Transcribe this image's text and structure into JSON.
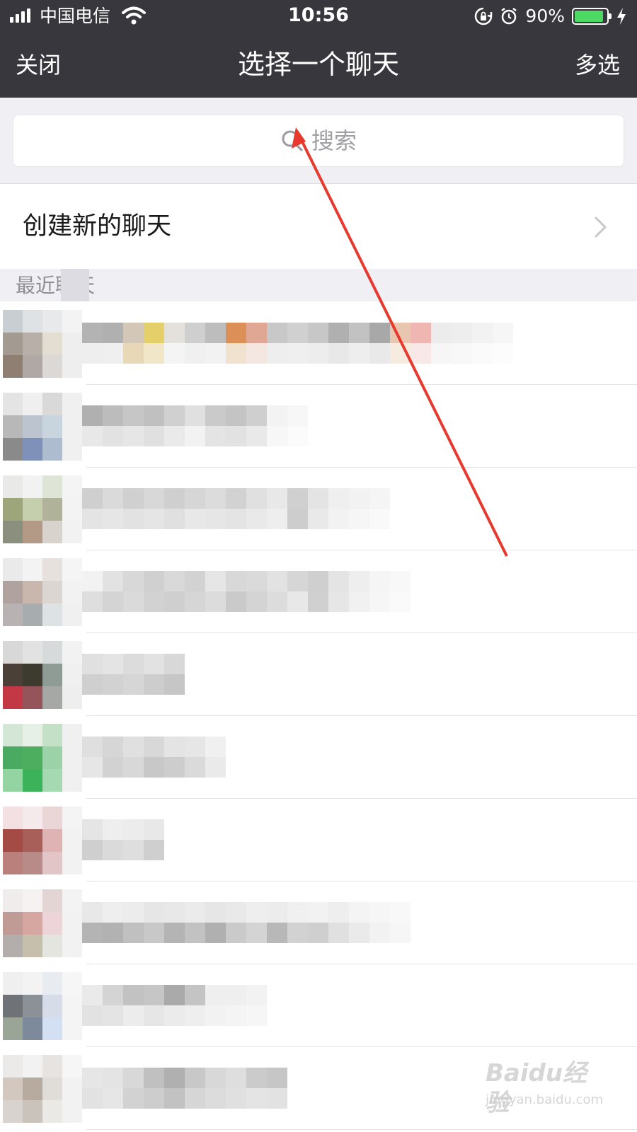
{
  "status_bar": {
    "carrier": "中国电信",
    "time": "10:56",
    "battery_percent": "90%",
    "battery_level": 0.9,
    "battery_color": "#4cd964",
    "icons": [
      "signal-icon",
      "wifi-icon",
      "rotation-lock-icon",
      "alarm-icon",
      "battery-icon",
      "charging-icon"
    ]
  },
  "navbar": {
    "left_label": "关闭",
    "title": "选择一个聊天",
    "right_label": "多选",
    "background": "#38373d"
  },
  "search": {
    "placeholder": "搜索",
    "icon": "search-icon"
  },
  "create_new": {
    "label": "创建新的聊天",
    "icon": "chevron-right-icon"
  },
  "section": {
    "label": "最近聊天"
  },
  "chats": [
    {
      "name": "(redacted)",
      "avatar_colors": [
        "#c9ced3",
        "#dfe2e5",
        "#e8e9ea",
        "#f3f3f3",
        "#a39a91",
        "#b8b0a8",
        "#e3ddd2",
        "#eeeeee",
        "#8f7f72",
        "#b0a8a5",
        "#dcd8d6",
        "#eeeeee"
      ],
      "name_colors": [
        "#b3b3b3",
        "#eeeeee",
        "#b0b0b0",
        "#efefef",
        "#d3c8b8",
        "#e9d8b8",
        "#e5cf6a",
        "#f2e6c8",
        "#e4e0dc",
        "#f4f4f4",
        "#cfcfcf",
        "#f0f0f0",
        "#bdbdbd",
        "#f2f2f2",
        "#dd8f58",
        "#f1e1cf",
        "#e0a894",
        "#f4e6e0",
        "#c8c8c8",
        "#eeeeee",
        "#d0d0d0",
        "#efefef",
        "#c7c7c7",
        "#ededed",
        "#b0b0b0",
        "#e8e8e8",
        "#c2c2c2",
        "#eeeeee",
        "#a8a8a8",
        "#e9e9e9",
        "#e8c6b0",
        "#f5ecdf",
        "#f0b7b2",
        "#f8e8e8",
        "#ececec",
        "#f6f6f6",
        "#eeeeee",
        "#f8f8f8",
        "#f2f2f2",
        "#fafafa",
        "#f6f6f6",
        "#fcfcfc"
      ]
    },
    {
      "name": "(redacted)",
      "avatar_colors": [
        "#e4e4e4",
        "#efefef",
        "#d9d9d9",
        "#f0f0f0",
        "#b8b8b8",
        "#bcc5cf",
        "#c8d4de",
        "#f0f0f0",
        "#8a8a8a",
        "#7f91b8",
        "#aebcd0",
        "#f0f0f0"
      ],
      "name_colors": [
        "#b0b0b0",
        "#e8e8e8",
        "#bcbcbc",
        "#e2e2e2",
        "#c6c6c6",
        "#e6e6e6",
        "#c0c0c0",
        "#e0e0e0",
        "#d0d0d0",
        "#eaeaea",
        "#e0e0e0",
        "#f2f2f2",
        "#cacaca",
        "#e4e4e4",
        "#c4c4c4",
        "#e2e2e2",
        "#cfcfcf",
        "#e9e9e9",
        "#f3f3f3",
        "#f7f7f7",
        "#f7f7f7",
        "#fbfbfb"
      ]
    },
    {
      "name": "(redacted)",
      "avatar_colors": [
        "#e9eae7",
        "#f2f2f2",
        "#dfe5d6",
        "#f4f4f4",
        "#9da57a",
        "#c5cfae",
        "#b0b39a",
        "#f3f3f3",
        "#8b8f7d",
        "#b29a86",
        "#d8d3cc",
        "#f2f2f2"
      ],
      "name_colors": [
        "#cfcfcf",
        "#e4e4e4",
        "#dadada",
        "#e6e6e6",
        "#d0d0d0",
        "#e2e2e2",
        "#d8d8d8",
        "#e5e5e5",
        "#cfcfcf",
        "#e0e0e0",
        "#d6d6d6",
        "#e8e8e8",
        "#dcdcdc",
        "#e6e6e6",
        "#d2d2d2",
        "#e4e4e4",
        "#e0e0e0",
        "#e9e9e9",
        "#e8e8e8",
        "#eeeeee",
        "#d0d0d0",
        "#cdcdcd",
        "#e4e4e4",
        "#e9e9e9",
        "#efefef",
        "#f2f2f2",
        "#f2f2f2",
        "#f6f6f6",
        "#f5f5f5",
        "#f9f9f9"
      ]
    },
    {
      "name": "(redacted)",
      "avatar_colors": [
        "#eaeaea",
        "#f3f3f3",
        "#e6e1dd",
        "#f5f5f5",
        "#b0a39f",
        "#c9b7ae",
        "#dcd6d3",
        "#f2f2f2",
        "#b8b3b2",
        "#a7adae",
        "#dde2e4",
        "#f0f0f0"
      ],
      "name_colors": [
        "#f2f2f2",
        "#dedede",
        "#e2e2e2",
        "#d4d4d4",
        "#d8d8d8",
        "#dadada",
        "#d0d0d0",
        "#d2d2d2",
        "#d9d9d9",
        "#cfcfcf",
        "#d2d2d2",
        "#d6d6d6",
        "#e6e6e6",
        "#dcdcdc",
        "#d8d8d8",
        "#cacaca",
        "#dadada",
        "#d4d4d4",
        "#e2e2e2",
        "#dcdcdc",
        "#d6d6d6",
        "#e8e8e8",
        "#cfcfcf",
        "#d0d0d0",
        "#e4e4e4",
        "#e6e6e6",
        "#eeeeee",
        "#f1f1f1",
        "#f5f5f5",
        "#f6f6f6",
        "#f8f8f8",
        "#fafafa"
      ]
    },
    {
      "name": "(redacted)",
      "avatar_colors": [
        "#d8d8d8",
        "#e2e2e2",
        "#d6dadb",
        "#f2f2f2",
        "#4a4038",
        "#3d3b2f",
        "#8f9b95",
        "#f0f0f0",
        "#c43846",
        "#955459",
        "#a6a8a5",
        "#eeeeee"
      ],
      "name_colors": [
        "#e0e0e0",
        "#cfcfcf",
        "#e4e4e4",
        "#d2d2d2",
        "#dcdcdc",
        "#d6d6d6",
        "#e2e2e2",
        "#cdcdcd",
        "#d8d8d8",
        "#c6c6c6"
      ]
    },
    {
      "name": "(redacted)",
      "avatar_colors": [
        "#d4e6d5",
        "#e6f0e6",
        "#c4e0c6",
        "#f0f0f0",
        "#4aaa62",
        "#4eae60",
        "#9bd2a7",
        "#f0f0f0",
        "#94d3a2",
        "#3cb25a",
        "#a4d9b1",
        "#f0f0f0"
      ],
      "name_colors": [
        "#dfdfdf",
        "#e6e6e6",
        "#d6d6d6",
        "#d2d2d2",
        "#e0e0e0",
        "#d8d8d8",
        "#d8d8d8",
        "#c8c8c8",
        "#e4e4e4",
        "#cdcdcd",
        "#e6e6e6",
        "#dadada",
        "#f0f0f0",
        "#eaeaea"
      ]
    },
    {
      "name": "(redacted)",
      "avatar_colors": [
        "#f3e0e2",
        "#f5eaeb",
        "#ead6d7",
        "#f4f4f4",
        "#a44b46",
        "#a85f59",
        "#dfb2b4",
        "#f2f2f2",
        "#b9807c",
        "#b88b89",
        "#e2c5c7",
        "#f2f2f2"
      ],
      "name_colors": [
        "#e5e5e5",
        "#cfcfcf",
        "#eeeeee",
        "#dadada",
        "#ececec",
        "#dedede",
        "#e8e8e8",
        "#cfcfcf"
      ]
    },
    {
      "name": "(redacted)",
      "avatar_colors": [
        "#f0eceb",
        "#f5f2f1",
        "#e4d5d5",
        "#f3f3f3",
        "#c09a94",
        "#d6a6a0",
        "#edd4d8",
        "#f2f2f2",
        "#b3aeab",
        "#c6bfac",
        "#e5e5df",
        "#f2f2f2"
      ],
      "name_colors": [
        "#e8e8e8",
        "#b4b4b4",
        "#eeeeee",
        "#b2b2b2",
        "#ececec",
        "#c0c0c0",
        "#e6e6e6",
        "#c8c8c8",
        "#e8e8e8",
        "#b4b4b4",
        "#ebebeb",
        "#c2c2c2",
        "#e6e6e6",
        "#b0b0b0",
        "#e9e9e9",
        "#cacaca",
        "#eeeeee",
        "#d4d4d4",
        "#ececec",
        "#b8b8b8",
        "#f0f0f0",
        "#d2d2d2",
        "#f2f2f2",
        "#cfcfcf",
        "#eeeeee",
        "#e0e0e0",
        "#f4f4f4",
        "#eaeaea",
        "#f6f6f6",
        "#f2f2f2",
        "#f8f8f8",
        "#f6f6f6"
      ]
    },
    {
      "name": "(redacted)",
      "avatar_colors": [
        "#efefef",
        "#f3f3f3",
        "#e8ebef",
        "#f6f6f6",
        "#6f7378",
        "#8b9196",
        "#d6dde8",
        "#f4f4f4",
        "#9aa497",
        "#7d8a9c",
        "#d3e0f4",
        "#f4f4f4"
      ],
      "name_colors": [
        "#eaeaea",
        "#e2e2e2",
        "#d4d4d4",
        "#e4e4e4",
        "#c2c2c2",
        "#ececec",
        "#c6c6c6",
        "#e6e6e6",
        "#aaaaaa",
        "#ebebeb",
        "#c4c4c4",
        "#eeeeee",
        "#efefef",
        "#f2f2f2",
        "#efefef",
        "#f4f4f4",
        "#f2f2f2",
        "#f6f6f6"
      ]
    },
    {
      "name": "(redacted)",
      "avatar_colors": [
        "#eceae8",
        "#f2f2f2",
        "#e6e3e0",
        "#f6f6f6",
        "#d2c8c0",
        "#b7ab9f",
        "#e0dcd7",
        "#f2f2f2",
        "#d8d3ce",
        "#c9c3bc",
        "#ebe9e6",
        "#f2f2f2"
      ],
      "name_colors": [
        "#e6e6e6",
        "#e2e2e2",
        "#e4e4e4",
        "#e6e6e6",
        "#d8d8d8",
        "#d2d2d2",
        "#c0c0c0",
        "#cdcdcd",
        "#b0b0b0",
        "#c2c2c2",
        "#c8c8c8",
        "#d6d6d6",
        "#d8d8d8",
        "#dcdcdc",
        "#dedede",
        "#e0e0e0",
        "#cbcbcb",
        "#e4e4e4",
        "#c6c6c6",
        "#e2e2e2"
      ]
    }
  ],
  "annotation": {
    "arrow_color": "#e8392e"
  },
  "watermark": {
    "brand": "Baidu经验",
    "url": "jingyan.baidu.com"
  }
}
